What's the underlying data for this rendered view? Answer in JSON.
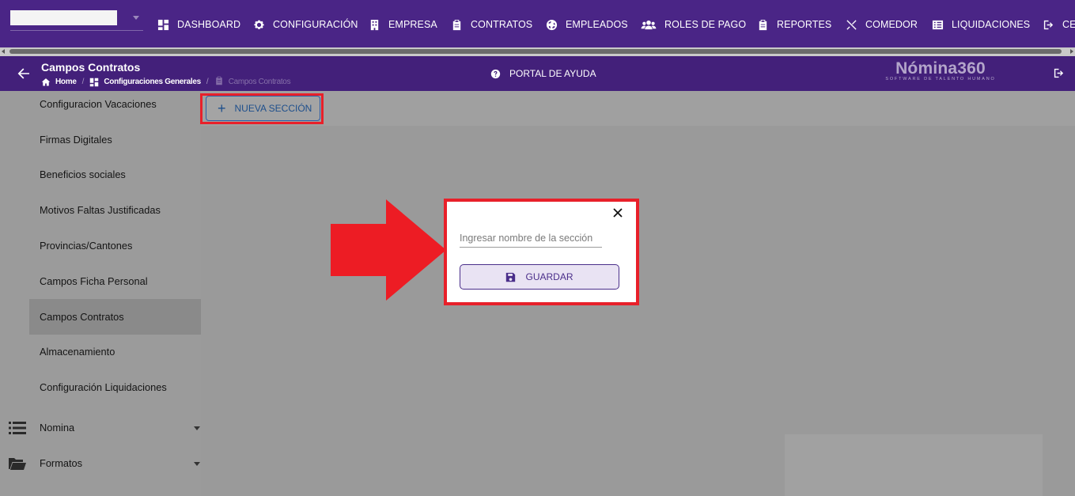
{
  "topnav": {
    "company_select_value": "",
    "items": [
      {
        "label": "DASHBOARD",
        "icon": "dashboard-icon"
      },
      {
        "label": "CONFIGURACIÓN",
        "icon": "gear-icon"
      },
      {
        "label": "EMPRESA",
        "icon": "building-icon"
      },
      {
        "label": "CONTRATOS",
        "icon": "clipboard-icon"
      },
      {
        "label": "EMPLEADOS",
        "icon": "globe-icon"
      },
      {
        "label": "ROLES DE PAGO",
        "icon": "users-icon"
      },
      {
        "label": "REPORTES",
        "icon": "clipboard-icon"
      },
      {
        "label": "COMEDOR",
        "icon": "utensils-icon"
      },
      {
        "label": "LIQUIDACIONES",
        "icon": "list-icon"
      },
      {
        "label": "CE",
        "icon": "logout-icon"
      }
    ]
  },
  "header": {
    "title": "Campos Contratos",
    "breadcrumb": [
      "Home",
      "Configuraciones Generales",
      "Campos Contratos"
    ],
    "help_label": "PORTAL DE AYUDA",
    "logo_main": "Nómina360",
    "logo_sub": "SOFTWARE DE TALENTO HUMANO"
  },
  "sidebar": {
    "items": [
      {
        "label": "Configuracion Vacaciones"
      },
      {
        "label": "Firmas Digitales"
      },
      {
        "label": "Beneficios sociales"
      },
      {
        "label": "Motivos Faltas Justificadas"
      },
      {
        "label": "Provincias/Cantones"
      },
      {
        "label": "Campos Ficha Personal"
      },
      {
        "label": "Campos Contratos",
        "active": true
      },
      {
        "label": "Almacenamiento"
      },
      {
        "label": "Configuración Liquidaciones"
      }
    ],
    "groups": [
      {
        "label": "Nomina",
        "icon": "list-icon"
      },
      {
        "label": "Formatos",
        "icon": "folder-open-icon"
      }
    ]
  },
  "toolbar": {
    "new_section_label": "NUEVA SECCIÓN"
  },
  "dialog": {
    "input_placeholder": "Ingresar nombre de la sección",
    "input_value": "",
    "save_label": "GUARDAR"
  },
  "colors": {
    "nav_purple": "#4a2586",
    "header_purple": "#43207a",
    "highlight_red": "#e8202a",
    "button_blue": "#1e4f8c",
    "save_purple": "#4a2e8a"
  }
}
